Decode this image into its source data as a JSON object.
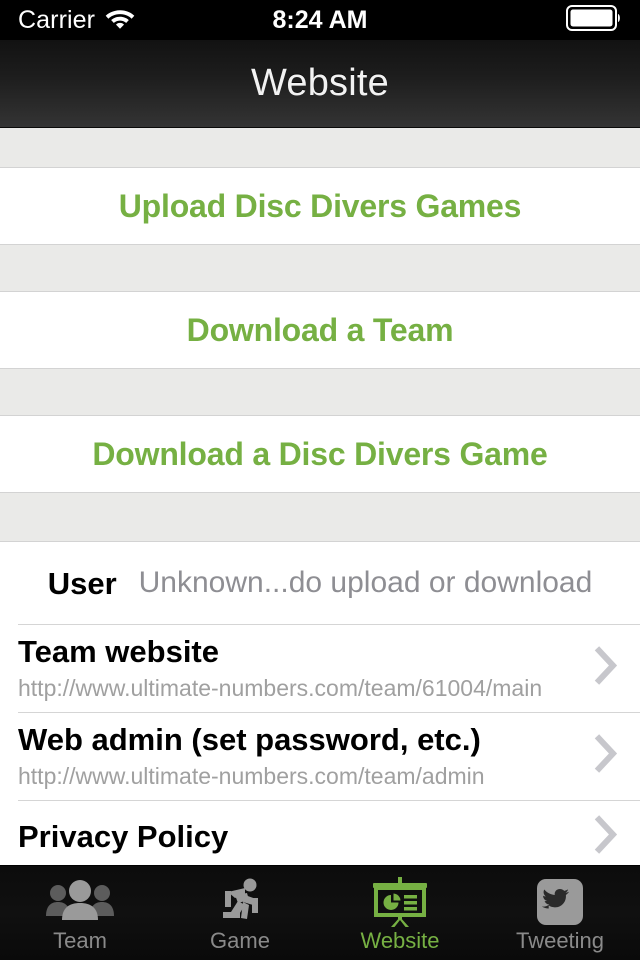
{
  "status_bar": {
    "carrier": "Carrier",
    "wifi_icon": "wifi-icon",
    "time": "8:24 AM",
    "battery_icon": "battery-full-icon"
  },
  "nav_bar": {
    "title": "Website"
  },
  "colors": {
    "accent_green": "#76b043",
    "section_background": "#eaeae8",
    "cell_background": "#ffffff",
    "secondary_text": "#8e8e93",
    "chevron": "#c7c7cc",
    "bar_background": "#0c0c0c"
  },
  "actions": [
    {
      "label": "Upload Disc Divers Games",
      "name": "upload-disc-divers-games-button"
    },
    {
      "label": "Download a Team",
      "name": "download-a-team-button"
    },
    {
      "label": "Download a Disc Divers Game",
      "name": "download-a-disc-divers-game-button"
    }
  ],
  "info": {
    "user_row": {
      "label": "User",
      "value": "Unknown...do upload or download"
    },
    "links": [
      {
        "title": "Team website",
        "subtitle": "http://www.ultimate-numbers.com/team/61004/main",
        "chevron_icon": "chevron-right-icon"
      },
      {
        "title": "Web admin (set password, etc.)",
        "subtitle": "http://www.ultimate-numbers.com/team/admin",
        "chevron_icon": "chevron-right-icon"
      },
      {
        "title": "Privacy Policy",
        "subtitle": "",
        "chevron_icon": "chevron-right-icon"
      }
    ]
  },
  "tab_bar": {
    "items": [
      {
        "label": "Team",
        "icon": "people-group-icon",
        "active": false
      },
      {
        "label": "Game",
        "icon": "running-person-icon",
        "active": false
      },
      {
        "label": "Website",
        "icon": "presentation-chart-icon",
        "active": true
      },
      {
        "label": "Tweeting",
        "icon": "twitter-bird-icon",
        "active": false
      }
    ]
  }
}
